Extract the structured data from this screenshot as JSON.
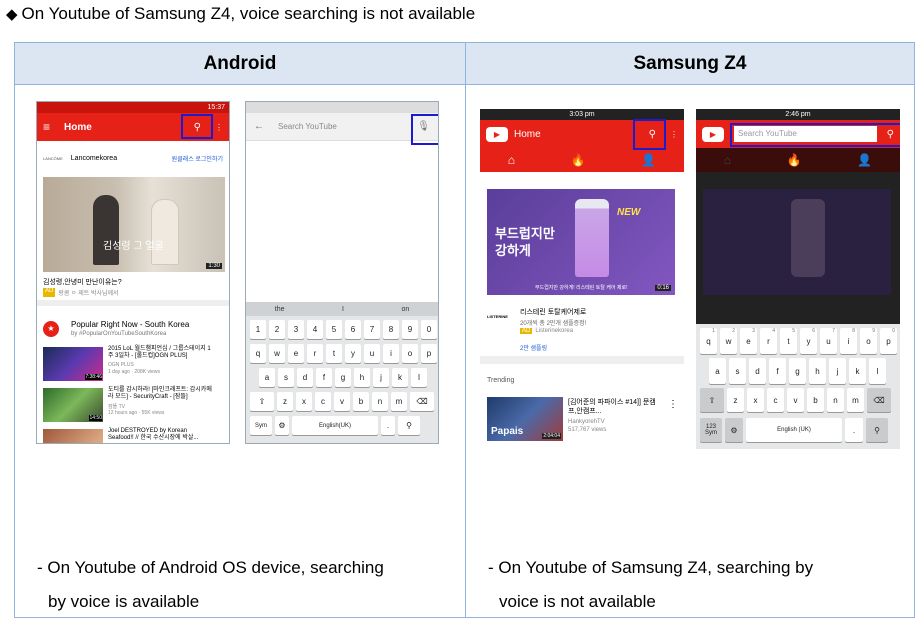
{
  "heading": {
    "bullet": "◆",
    "text": "On Youtube of Samsung Z4, voice searching is not available"
  },
  "table": {
    "col1_header": "Android",
    "col2_header": "Samsung Z4",
    "col1_note_line1": "- On Youtube of Android OS device, searching",
    "col1_note_line2": "by voice is available",
    "col2_note_line1": "- On Youtube of Samsung Z4, searching by",
    "col2_note_line2": "voice is not available"
  },
  "android_home": {
    "time": "15:37",
    "title": "Home",
    "channel": "Lancomekorea",
    "channel_action": "원클래스 로그인하기",
    "video_duration": "1:30",
    "video_overlay": "김성령 그 얼굴",
    "video_title": "김성령,안녕미 만난이유는?",
    "ad_badge": "AD",
    "ad_text": "랑콤 ㅇ 제트 박사님께서",
    "section_title": "Popular Right Now - South Korea",
    "section_sub": "by #PopularOnYouTubeSouthKorea",
    "items": [
      {
        "title": "2015 LoL 월드챔피언십 / 그룹스테이지 1주 3일차 - [롤드컵]OGN PLUS]",
        "meta": "OGN PLUS",
        "meta2": "1 day ago · 208K views",
        "duration": "7:38:46"
      },
      {
        "title": "도티를 감시하라! [마인크래프트: 감시카메라 모드] - SecurityCraft - [잠뜰]",
        "meta": "잠뜰 TV",
        "meta2": "12 hours ago · 55K views",
        "duration": "14:50"
      },
      {
        "title": "Joel DESTROYED by Korean Seafood!! // 한국 수산시장에 박살...",
        "meta": "",
        "meta2": "",
        "duration": ""
      }
    ]
  },
  "android_search": {
    "placeholder": "Search YouTube",
    "suggestions": [
      "the",
      "I",
      "on"
    ],
    "rows": [
      [
        "1",
        "2",
        "3",
        "4",
        "5",
        "6",
        "7",
        "8",
        "9",
        "0"
      ],
      [
        "q",
        "w",
        "e",
        "r",
        "t",
        "y",
        "u",
        "i",
        "o",
        "p"
      ],
      [
        "a",
        "s",
        "d",
        "f",
        "g",
        "h",
        "j",
        "k",
        "l"
      ],
      [
        "z",
        "x",
        "c",
        "v",
        "b",
        "n",
        "m"
      ]
    ],
    "sym": "Sym",
    "space": "English(UK)"
  },
  "samsung_home": {
    "time": "3:03 pm",
    "title": "Home",
    "banner_text": "부드럽지만 강하게",
    "banner_new": "NEW",
    "banner_caption": "부드럽지만 강하게! 리스테린 토탈 케어 제로!",
    "banner_duration": "0:16",
    "brand_logo": "LISTERINE",
    "ad_title": "리스테린 토탈케어제로",
    "ad_desc": "20개씩 총 2만개 샘플증정!",
    "ad_badge": "AD",
    "ad_channel": "Listerinekorea",
    "ad_link": "2만 샘플링",
    "trending_label": "Trending",
    "trend_title": "[김어준의 파파이스 #14]] 문캠프,안캠프...",
    "trend_channel": "HankyorehTV",
    "trend_views": "517,767 views",
    "trend_duration": "2:04:04",
    "trend_overlay": "Papais"
  },
  "samsung_search": {
    "time": "2:46 pm",
    "placeholder": "Search YouTube",
    "rows": [
      [
        "q",
        "w",
        "e",
        "r",
        "t",
        "y",
        "u",
        "i",
        "o",
        "p"
      ],
      [
        "a",
        "s",
        "d",
        "f",
        "g",
        "h",
        "j",
        "k",
        "l"
      ],
      [
        "z",
        "x",
        "c",
        "v",
        "b",
        "n",
        "m"
      ]
    ],
    "num_hints": [
      "1",
      "2",
      "3",
      "4",
      "5",
      "6",
      "7",
      "8",
      "9",
      "0"
    ],
    "sym_label": "123\nSym",
    "space": "English (UK)"
  },
  "colors": {
    "youtube_red": "#e62117",
    "highlight_blue": "#1b1bd0",
    "header_bg": "#dce6f2",
    "border": "#8fb4e0"
  }
}
